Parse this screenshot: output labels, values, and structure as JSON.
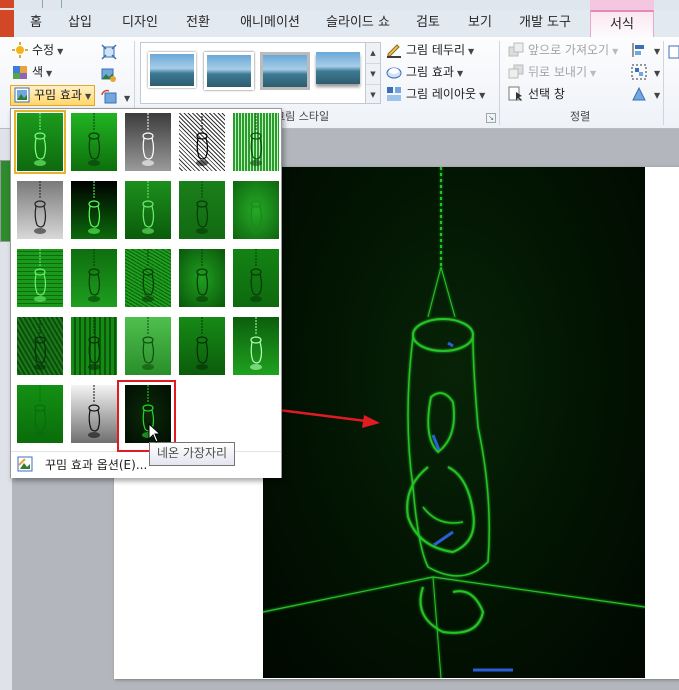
{
  "ribbon": {
    "tabs": [
      {
        "label": "홈"
      },
      {
        "label": "삽입"
      },
      {
        "label": "디자인"
      },
      {
        "label": "전환"
      },
      {
        "label": "애니메이션"
      },
      {
        "label": "슬라이드 쇼"
      },
      {
        "label": "검토"
      },
      {
        "label": "보기"
      },
      {
        "label": "개발 도구"
      },
      {
        "label": "서식"
      }
    ],
    "adjust": {
      "corrections": "수정",
      "color": "색",
      "artistic_effects": "꾸밈 효과"
    },
    "picture_styles": {
      "group_label": "그림 스타일",
      "border": "그림 테두리",
      "effects": "그림 효과",
      "layout": "그림 레이아웃"
    },
    "arrange": {
      "group_label": "정렬",
      "bring_forward": "앞으로 가져오기",
      "send_backward": "뒤로 보내기",
      "selection_pane": "선택 창"
    }
  },
  "artistic_dropdown": {
    "options_label": "꾸밈 효과 옵션(E)...",
    "tooltip": "네온 가장자리",
    "selected_index": 0,
    "hovered_index": 22,
    "effects": [
      {
        "style": "none"
      },
      {
        "style": "marker"
      },
      {
        "style": "pencil-gray"
      },
      {
        "style": "pencil-sketch"
      },
      {
        "style": "line-drawing"
      },
      {
        "style": "chalk"
      },
      {
        "style": "paint-strokes"
      },
      {
        "style": "paint-brush"
      },
      {
        "style": "glow-diffused"
      },
      {
        "style": "blur"
      },
      {
        "style": "light-screen"
      },
      {
        "style": "watercolor"
      },
      {
        "style": "film-grain"
      },
      {
        "style": "mosaic-bubbles"
      },
      {
        "style": "glass"
      },
      {
        "style": "cement"
      },
      {
        "style": "texturizer"
      },
      {
        "style": "crisscross-etching"
      },
      {
        "style": "pastels-smooth"
      },
      {
        "style": "plastic-wrap"
      },
      {
        "style": "cutout"
      },
      {
        "style": "photocopy"
      },
      {
        "style": "glow-edges"
      }
    ]
  },
  "colors": {
    "accent_highlight": "#ffd66a",
    "annotation_red": "#e11b22",
    "neon_green": "#2bd62b"
  }
}
